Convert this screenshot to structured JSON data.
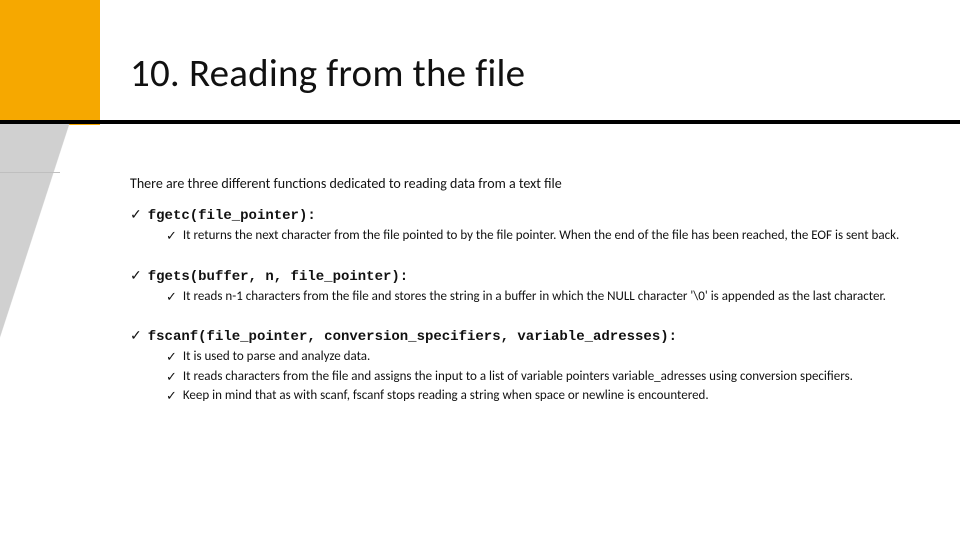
{
  "title": "10.  Reading from the file",
  "intro": "There are three different functions dedicated to reading data from a text file",
  "tick": "✓",
  "items": [
    {
      "signature": "fgetc(file_pointer):",
      "subs": [
        "It returns the next character from the file pointed to by the file pointer. When the end of the file has been reached, the EOF is sent back."
      ]
    },
    {
      "signature": "fgets(buffer, n, file_pointer):",
      "subs": [
        "It reads n-1 characters from the file and stores the string in a buffer in which the NULL character '\\0' is appended as the last character."
      ]
    },
    {
      "signature": "fscanf(file_pointer, conversion_specifiers, variable_adresses):",
      "subs": [
        "It is used to parse and analyze data.",
        "It reads characters from the file and assigns the input to a list of variable pointers variable_adresses using conversion specifiers.",
        "Keep in mind that as with scanf, fscanf stops reading a string when space or newline is encountered."
      ]
    }
  ]
}
